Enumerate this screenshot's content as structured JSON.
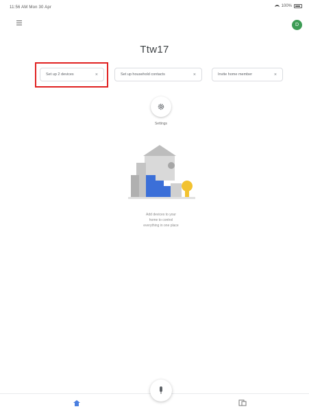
{
  "status_bar": {
    "time": "11:56 AM  Mon 30 Apr",
    "battery": "100%"
  },
  "header": {
    "title": "Ttw17",
    "avatar_initial": "D"
  },
  "chips": [
    {
      "label": "Set up 2 devices",
      "icon": "close-icon"
    },
    {
      "label": "Set up household contacts",
      "icon": "close-icon"
    },
    {
      "label": "Invite home member",
      "icon": "close-icon"
    }
  ],
  "settings": {
    "label": "Settings",
    "icon": "gear-icon"
  },
  "empty_state": {
    "line1": "Add devices to your",
    "line2": "home to control",
    "line3": "everything in one place"
  },
  "bottom_nav": {
    "home_icon": "home-icon",
    "devices_icon": "devices-icon",
    "mic_icon": "mic-icon"
  },
  "colors": {
    "accent": "#3d9c55",
    "highlight": "#e02020",
    "illustration_blue": "#3b6fd8",
    "illustration_yellow": "#f2c230"
  }
}
